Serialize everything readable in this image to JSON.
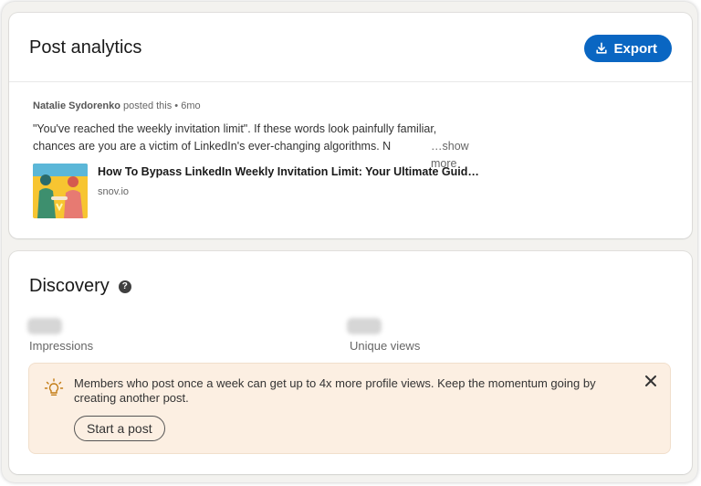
{
  "header": {
    "title": "Post analytics",
    "export_label": "Export"
  },
  "post": {
    "author": "Natalie Sydorenko",
    "meta_suffix": " posted this • 6mo",
    "text_line1": "\"You've reached the weekly invitation limit\". If these words look painfully familiar,",
    "text_line2": "chances are you are a victim of LinkedIn's ever-changing algorithms. N",
    "show_more": "…show more",
    "link_title": "How To Bypass LinkedIn Weekly Invitation Limit: Your Ultimate Guid…",
    "link_domain": "snov.io"
  },
  "discovery": {
    "title": "Discovery",
    "help_glyph": "?",
    "metrics": [
      {
        "label": "Impressions",
        "value_hidden": true
      },
      {
        "label": "Unique views",
        "value_hidden": true
      }
    ],
    "tip": {
      "text": "Members who post once a week can get up to 4x more profile views. Keep the momentum going by creating another post.",
      "button_label": "Start a post"
    }
  },
  "colors": {
    "accent": "#0a66c2",
    "tip_background": "#fcefe2",
    "tip_icon": "#c37d16"
  },
  "icons": {
    "export": "download-icon",
    "help": "question-circle-icon",
    "tip": "lightbulb-icon",
    "close": "close-icon"
  }
}
